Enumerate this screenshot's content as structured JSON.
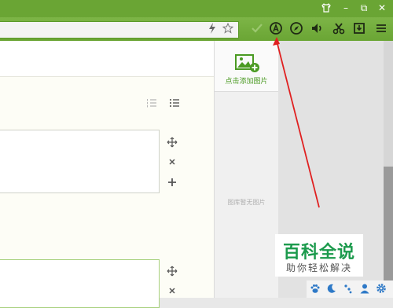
{
  "window": {
    "shirt_icon": "shirt-icon",
    "minimize": "–",
    "restore": "⧉",
    "close": "✕"
  },
  "toolbar": {
    "icons": [
      "check-icon",
      "adblock-icon",
      "compass-icon",
      "speaker-icon",
      "scissors-icon",
      "download-icon",
      "menu-icon"
    ]
  },
  "editor": {
    "controls_1": [
      "move-icon",
      "close-icon",
      "add-icon"
    ],
    "controls_2": [
      "move-icon",
      "close-icon"
    ]
  },
  "sidebar": {
    "add_picture_label": "点击添加图片",
    "no_picture_text": "图库暂无图片"
  },
  "watermark": {
    "title": "百科全说",
    "subtitle": "助你轻松解决"
  },
  "statusbar": {
    "icons": [
      "paw-icon",
      "moon-icon",
      "dots-icon",
      "user-icon",
      "settings-icon"
    ]
  },
  "colors": {
    "brand_green": "#6aa534",
    "accent_green": "#4a9a22",
    "annotation_red": "#e02020"
  }
}
